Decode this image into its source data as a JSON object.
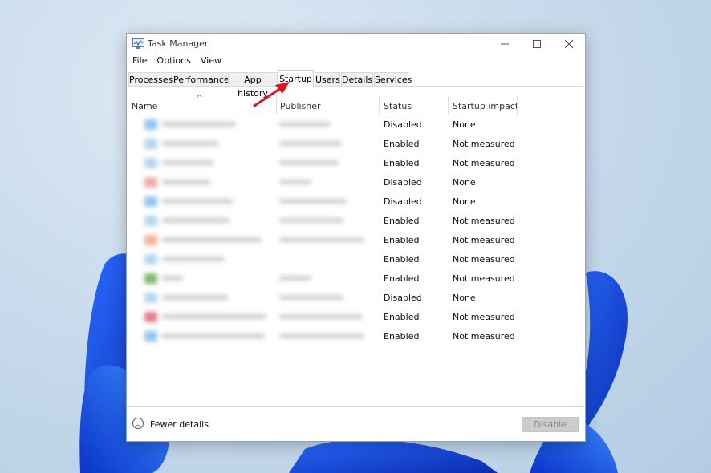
{
  "window": {
    "title": "Task Manager"
  },
  "menu": [
    "File",
    "Options",
    "View"
  ],
  "tabs": [
    "Processes",
    "Performance",
    "App history",
    "Startup",
    "Users",
    "Details",
    "Services"
  ],
  "active_tab": "Startup",
  "columns": {
    "name": "Name",
    "publisher": "Publisher",
    "status": "Status",
    "impact": "Startup impact"
  },
  "rows": [
    {
      "status": "Disabled",
      "impact": "None",
      "icon_color": "#8fc6f0"
    },
    {
      "status": "Enabled",
      "impact": "Not measured",
      "icon_color": "#b9d6ee"
    },
    {
      "status": "Enabled",
      "impact": "Not measured",
      "icon_color": "#b9d6ee"
    },
    {
      "status": "Disabled",
      "impact": "None",
      "icon_color": "#f1a9a9"
    },
    {
      "status": "Disabled",
      "impact": "None",
      "icon_color": "#8fc6f0"
    },
    {
      "status": "Enabled",
      "impact": "Not measured",
      "icon_color": "#b9d6ee"
    },
    {
      "status": "Enabled",
      "impact": "Not measured",
      "icon_color": "#f2b49c"
    },
    {
      "status": "Enabled",
      "impact": "Not measured",
      "icon_color": "#b9d6ee"
    },
    {
      "status": "Enabled",
      "impact": "Not measured",
      "icon_color": "#7db86a"
    },
    {
      "status": "Disabled",
      "impact": "None",
      "icon_color": "#b9d6ee"
    },
    {
      "status": "Enabled",
      "impact": "Not measured",
      "icon_color": "#e67a90"
    },
    {
      "status": "Enabled",
      "impact": "Not measured",
      "icon_color": "#8fc6f0"
    }
  ],
  "footer": {
    "fewer_details": "Fewer details",
    "disable": "Disable"
  },
  "colors": {
    "annotation_arrow": "#e0141e",
    "accent": "#1a5fe0"
  }
}
